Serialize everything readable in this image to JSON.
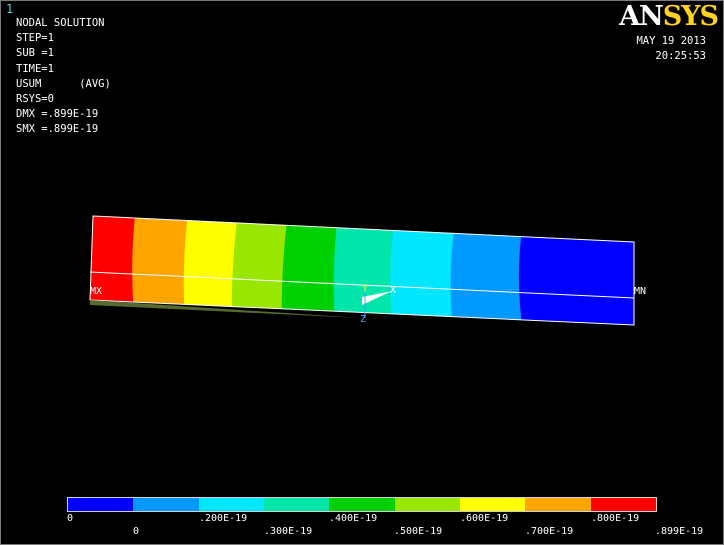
{
  "window_number": "1",
  "logo": {
    "a": "AN",
    "b": "SYS"
  },
  "info": {
    "title": "NODAL SOLUTION",
    "lines": [
      "STEP=1",
      "SUB =1",
      "TIME=1",
      "USUM      (AVG)",
      "RSYS=0",
      "DMX =.899E-19",
      "SMX =.899E-19"
    ]
  },
  "date": "MAY 19 2013",
  "time": "20:25:53",
  "model_labels": {
    "mx": "MX",
    "mn": "MN",
    "x_axis": "X",
    "y_axis": "Y",
    "z_axis": "Z"
  },
  "legend": {
    "colors": [
      "#0000ff",
      "#0099ff",
      "#00e6ff",
      "#00e6aa",
      "#00d000",
      "#99e600",
      "#ffff00",
      "#ffa500",
      "#ff0000"
    ],
    "ticks_top": [
      "0",
      ".200E-19",
      ".400E-19",
      ".600E-19",
      ".800E-19"
    ],
    "ticks_bottom": [
      "0",
      ".300E-19",
      ".500E-19",
      ".700E-19",
      ".899E-19"
    ]
  }
}
